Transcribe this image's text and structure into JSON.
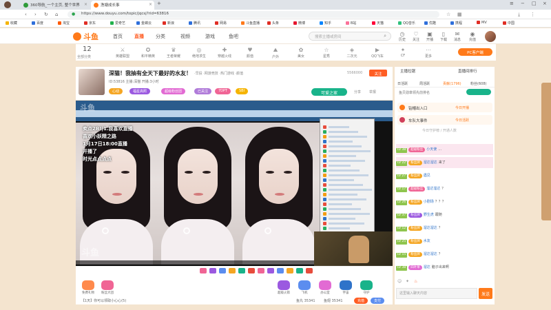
{
  "browser": {
    "tabs": [
      {
        "title": "360导航_一个主页, 整个世界",
        "fav_color": "#2f9b3a"
      },
      {
        "title": "渔塘成长事",
        "fav_color": "#ff7a1a"
      }
    ],
    "new_tab": "+",
    "close_glyph": "×",
    "url": "https://www.douyu.com/topic/jqcsj?rid=63816",
    "bookmarks": [
      {
        "label": "收藏",
        "color": "#f5b400"
      },
      {
        "label": "百度",
        "color": "#2f6fdb"
      },
      {
        "label": "淘宝",
        "color": "#ff5a00"
      },
      {
        "label": "京东",
        "color": "#e02e24"
      },
      {
        "label": "爱奇艺",
        "color": "#22b14c"
      },
      {
        "label": "金蝶云",
        "color": "#2f6fdb"
      },
      {
        "label": "新浪",
        "color": "#e02e24"
      },
      {
        "label": "腾讯",
        "color": "#2f6fdb"
      },
      {
        "label": "网易",
        "color": "#e02e24"
      },
      {
        "label": "斗鱼直播",
        "color": "#ff7a1a"
      },
      {
        "label": "头条",
        "color": "#e02e24"
      },
      {
        "label": "微博",
        "color": "#e6162d"
      },
      {
        "label": "知乎",
        "color": "#0084ff"
      },
      {
        "label": "B站",
        "color": "#fb7299"
      },
      {
        "label": "天猫",
        "color": "#ff0036"
      },
      {
        "label": "QQ音乐",
        "color": "#31c27c"
      },
      {
        "label": "优酷",
        "color": "#2f6fdb"
      },
      {
        "label": "携程",
        "color": "#2f6fdb"
      },
      {
        "label": "MV",
        "color": "#e02e24"
      },
      {
        "label": "中国",
        "color": "#e02e24"
      }
    ]
  },
  "site": {
    "logo_text": "斗鱼",
    "nav": [
      "首页",
      "直播",
      "分类",
      "视频",
      "游戏",
      "鱼吧"
    ],
    "active_nav": 1,
    "search_placeholder": "搜索主播或房间",
    "header_icons": [
      "历史",
      "关注",
      "开播",
      "下载",
      "消息",
      "充值"
    ],
    "categories": {
      "count": "12",
      "count_label": "全部分类",
      "items": [
        "英雄联盟",
        "和平精英",
        "王者荣耀",
        "绝地求生",
        "穿越火线",
        "颜值",
        "户外",
        "美女",
        "星秀",
        "二次元",
        "QQ飞车",
        "CF",
        "更多"
      ]
    },
    "pc_client": "PC客户端"
  },
  "room": {
    "title": "深猫！我抽有全天下最好的水友！",
    "tags": "·早投 ·网游竞技 ·热门游戏 ·颜值",
    "meta": "ID:53816  主播:深猫  开播:3小时",
    "chips": [
      {
        "label": "心动",
        "color": "#f5a623"
      },
      {
        "label": "福星高照",
        "color": "#9b59e0"
      },
      {
        "label": "超级粉丝团",
        "color": "#e26bd3"
      },
      {
        "label": "已关注",
        "color": "#b07bd9"
      },
      {
        "label": "7DPT",
        "color": "#f06595"
      },
      {
        "label": "SBI",
        "color": "#f5b400"
      }
    ],
    "fans": "5566000",
    "follow": "关注",
    "cheer": "可爱之家",
    "share": "分享",
    "report": "举报"
  },
  "player": {
    "overlay_lines": [
      "卖点2B!|1.我喜欢直播",
      "喜欢小妖精之路",
      "1月17日18:00直播",
      "开播了",
      "时光点点点点"
    ],
    "watermark": "斗鱼",
    "watermark_bottom": "斗鱼"
  },
  "gifts": {
    "items": [
      "免费礼物",
      "粉丝大团",
      "超级火箭",
      "飞机",
      "办公室",
      "宇宙",
      "守护"
    ],
    "balance": "鱼丸 35341",
    "balance2": "鱼翅 35341",
    "recharge": "充值",
    "pay": "支付",
    "notice": "【1天】你可以领取小心心(5)"
  },
  "chat": {
    "tabs": [
      "主播拉锯",
      "直播间排行"
    ],
    "rank_tabs": [
      "日活跃",
      "周活跃",
      "贡献(1796)",
      "粉丝(608)"
    ],
    "rank_header": "鱼贝勋章领先前排名",
    "rank_rows": [
      {
        "name": "钻帽出入口",
        "tag": "今日开播"
      },
      {
        "name": "车队大事件",
        "tag": "今日活跃"
      }
    ],
    "rank_more": "今日守护榜 / 开通人数",
    "messages": [
      {
        "lvl": "LV 38",
        "badge": "超级粉丝",
        "bcolor": "#f06595",
        "nick": "小天使",
        "text": "…",
        "hl": true
      },
      {
        "lvl": "LV 22",
        "badge": "粉丝牌",
        "bcolor": "#f5a623",
        "nick": "溜达溜达",
        "text": "来了",
        "hl": true
      },
      {
        "lvl": "LV 27",
        "badge": "粉丝牌",
        "bcolor": "#f5a623",
        "nick": "遇见",
        "text": "",
        "hl": false
      },
      {
        "lvl": "LV 17",
        "badge": "超级粉丝",
        "bcolor": "#f06595",
        "nick": "溜达溜达",
        "text": "？",
        "hl": false
      },
      {
        "lvl": "LV 26",
        "badge": "粉丝牌",
        "bcolor": "#f5a623",
        "nick": "小剧场",
        "text": "？？？",
        "hl": false
      },
      {
        "lvl": "LV 37",
        "badge": "粉丝牌",
        "bcolor": "#9b59e0",
        "nick": "野生虎",
        "text": "跟随",
        "hl": false
      },
      {
        "lvl": "LV 12",
        "badge": "粉丝牌",
        "bcolor": "#f5a623",
        "nick": "溜达溜达",
        "text": "？",
        "hl": false
      },
      {
        "lvl": "LV 25",
        "badge": "粉丝牌",
        "bcolor": "#f5a623",
        "nick": "水友",
        "text": "",
        "hl": false
      },
      {
        "lvl": "LV 15",
        "badge": "粉丝牌",
        "bcolor": "#f5a623",
        "nick": "溜达溜达",
        "text": "？",
        "hl": false
      },
      {
        "lvl": "LV 38",
        "badge": "四叶草",
        "bcolor": "#e26bd3",
        "nick": "溜达",
        "text": "脑子出来啊",
        "hl": false
      }
    ],
    "input_placeholder": "这里输入聊天内容",
    "send": "发送"
  }
}
